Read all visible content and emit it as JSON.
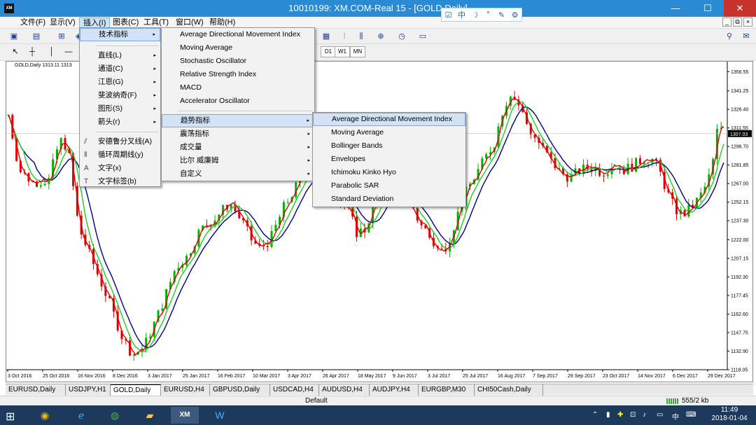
{
  "window": {
    "title": "10010199: XM.COM-Real 15 - [GOLD,Daily]",
    "logo": "XM",
    "minimize": "—",
    "maximize": "☐",
    "close": "✕"
  },
  "ime": [
    "☑",
    "中",
    "☽",
    "°",
    "✎",
    "⚙"
  ],
  "menubar": [
    {
      "label": "文件(F)"
    },
    {
      "label": "显示(V)"
    },
    {
      "label": "插入(I)"
    },
    {
      "label": "图表(C)"
    },
    {
      "label": "工具(T)"
    },
    {
      "label": "窗口(W)"
    },
    {
      "label": "帮助(H)"
    }
  ],
  "mdi_buttons": [
    "_",
    "⧉",
    "×"
  ],
  "timeframes": [
    "D1",
    "W1",
    "MN"
  ],
  "chart_label": "GOLD,Daily  1313.11 1313",
  "insert_menu": {
    "items": [
      {
        "label": "技术指标",
        "arrow": "▸"
      },
      {
        "label": "直线(L)",
        "arrow": "▸"
      },
      {
        "label": "通道(C)",
        "arrow": "▸"
      },
      {
        "label": "江恩(G)",
        "arrow": "▸"
      },
      {
        "label": "斐波纳奇(F)",
        "arrow": "▸"
      },
      {
        "label": "图形(S)",
        "arrow": "▸"
      },
      {
        "label": "箭头(r)",
        "arrow": "▸"
      },
      {
        "label": "安德鲁分叉线(A)"
      },
      {
        "label": "循环周期线(y)"
      },
      {
        "label": "文字(x)"
      },
      {
        "label": "文字标签(b)"
      }
    ]
  },
  "tech_menu": {
    "items": [
      {
        "label": "Average Directional Movement Index"
      },
      {
        "label": "Moving Average"
      },
      {
        "label": "Stochastic Oscillator"
      },
      {
        "label": "Relative Strength Index"
      },
      {
        "label": "MACD"
      },
      {
        "label": "Accelerator Oscillator"
      },
      {
        "label": "趋势指标",
        "arrow": "▸"
      },
      {
        "label": "震荡指标",
        "arrow": "▸"
      },
      {
        "label": "成交量",
        "arrow": "▸"
      },
      {
        "label": "比尔 威廉姆",
        "arrow": "▸"
      },
      {
        "label": "自定义",
        "arrow": "▸"
      }
    ]
  },
  "trend_menu": {
    "items": [
      {
        "label": "Average Directional Movement Index"
      },
      {
        "label": "Moving Average"
      },
      {
        "label": "Bollinger Bands"
      },
      {
        "label": "Envelopes"
      },
      {
        "label": "Ichimoku Kinko Hyo"
      },
      {
        "label": "Parabolic SAR"
      },
      {
        "label": "Standard Deviation"
      }
    ]
  },
  "tabs": [
    "EURUSD,Daily",
    "USDJPY,H1",
    "GOLD,Daily",
    "EURUSD,H4",
    "GBPUSD,Daily",
    "USDCAD,H4",
    "AUDUSD,H4",
    "AUDJPY,H4",
    "EURGBP,M30",
    "CHI50Cash,Daily"
  ],
  "status": {
    "profile": "Default",
    "traffic": "555/2 kb"
  },
  "taskbar": {
    "time": "11:49",
    "date": "2018-01-04",
    "ime": "中"
  },
  "colors": {
    "bull": "#00b000",
    "bear": "#e00000",
    "ma_fast": "#e00000",
    "ma_mid": "#22cc22",
    "ma_slow": "#000080",
    "price_tag": "#000000"
  },
  "chart_data": {
    "type": "candlestick",
    "title": "GOLD,Daily",
    "current_price": 1307.03,
    "ylim": [
      1118.05,
      1363.5
    ],
    "y_ticks": [
      "1356.55",
      "1341.25",
      "1326.40",
      "1311.55",
      "1296.70",
      "1281.85",
      "1267.00",
      "1252.15",
      "1237.30",
      "1222.00",
      "1207.15",
      "1192.30",
      "1177.45",
      "1162.60",
      "1147.75",
      "1132.90",
      "1118.05"
    ],
    "x_ticks": [
      "3 Oct 2016",
      "25 Oct 2016",
      "16 Nov 2016",
      "8 Dec 2016",
      "3 Jan 2017",
      "25 Jan 2017",
      "16 Feb 2017",
      "10 Mar 2017",
      "3 Apr 2017",
      "26 Apr 2017",
      "18 May 2017",
      "9 Jun 2017",
      "3 Jul 2017",
      "25 Jul 2017",
      "16 Aug 2017",
      "7 Sep 2017",
      "29 Sep 2017",
      "23 Oct 2017",
      "14 Nov 2017",
      "6 Dec 2017",
      "29 Dec 2017"
    ],
    "anchors": [
      [
        0,
        1322
      ],
      [
        8,
        1278
      ],
      [
        18,
        1268
      ],
      [
        30,
        1270
      ],
      [
        38,
        1302
      ],
      [
        44,
        1296
      ],
      [
        52,
        1232
      ],
      [
        64,
        1200
      ],
      [
        74,
        1174
      ],
      [
        84,
        1145
      ],
      [
        92,
        1130
      ],
      [
        100,
        1135
      ],
      [
        112,
        1165
      ],
      [
        124,
        1200
      ],
      [
        132,
        1208
      ],
      [
        142,
        1230
      ],
      [
        152,
        1238
      ],
      [
        164,
        1252
      ],
      [
        174,
        1235
      ],
      [
        180,
        1222
      ],
      [
        186,
        1215
      ],
      [
        194,
        1222
      ],
      [
        204,
        1248
      ],
      [
        212,
        1262
      ],
      [
        218,
        1275
      ],
      [
        226,
        1280
      ],
      [
        234,
        1278
      ],
      [
        240,
        1265
      ],
      [
        246,
        1252
      ],
      [
        252,
        1245
      ],
      [
        258,
        1228
      ],
      [
        264,
        1230
      ],
      [
        272,
        1252
      ],
      [
        278,
        1262
      ],
      [
        284,
        1270
      ],
      [
        292,
        1255
      ],
      [
        300,
        1244
      ],
      [
        308,
        1232
      ],
      [
        314,
        1220
      ],
      [
        320,
        1212
      ],
      [
        326,
        1220
      ],
      [
        332,
        1240
      ],
      [
        338,
        1258
      ],
      [
        344,
        1270
      ],
      [
        352,
        1285
      ],
      [
        360,
        1300
      ],
      [
        366,
        1325
      ],
      [
        372,
        1340
      ],
      [
        378,
        1330
      ],
      [
        386,
        1310
      ],
      [
        394,
        1298
      ],
      [
        402,
        1285
      ],
      [
        410,
        1275
      ],
      [
        416,
        1272
      ],
      [
        424,
        1278
      ],
      [
        432,
        1280
      ],
      [
        440,
        1276
      ],
      [
        448,
        1282
      ],
      [
        456,
        1278
      ],
      [
        464,
        1282
      ],
      [
        472,
        1288
      ],
      [
        478,
        1286
      ],
      [
        482,
        1278
      ],
      [
        488,
        1260
      ],
      [
        494,
        1246
      ],
      [
        500,
        1242
      ],
      [
        506,
        1248
      ],
      [
        512,
        1256
      ],
      [
        518,
        1268
      ],
      [
        522,
        1285
      ],
      [
        526,
        1316
      ],
      [
        530,
        1308
      ]
    ],
    "n_bars": 531
  }
}
